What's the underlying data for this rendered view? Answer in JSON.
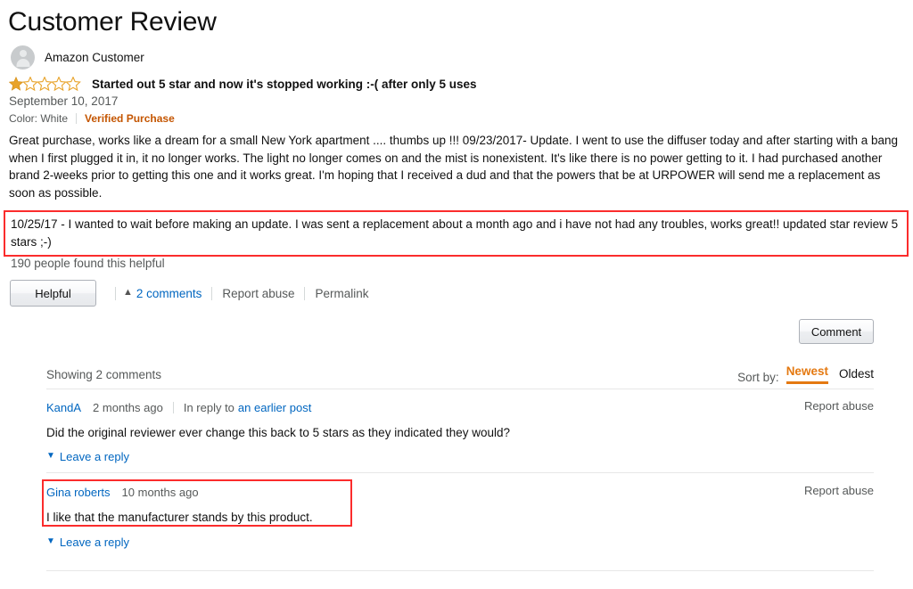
{
  "page": {
    "title": "Customer Review"
  },
  "reviewer": {
    "name": "Amazon Customer",
    "avatar_icon": "person-avatar-icon"
  },
  "review": {
    "rating_filled": 1,
    "rating_total": 5,
    "rating_icon": "star-icon",
    "headline": "Started out 5 star and now it's stopped working :-( after only 5 uses",
    "date": "September 10, 2017",
    "color_attribute": "Color: White",
    "verified_purchase": "Verified Purchase",
    "body": "Great purchase, works like a dream for a small New York apartment .... thumbs up !!! 09/23/2017- Update. I went to use the diffuser today and after starting with a bang when I first plugged it in, it no longer works. The light no longer comes on and the mist is nonexistent. It's like there is no power getting to it. I had purchased another brand 2-weeks prior to getting this one and it works great. I'm hoping that I received a dud and that the powers that be at URPOWER will send me a replacement as soon as possible.",
    "update_highlight": "10/25/17 - I wanted to wait before making an update. I was sent a replacement about a month ago and i have not had any troubles, works great!! updated star review 5 stars ;-)",
    "helpful_count_text": "190 people found this helpful"
  },
  "actions": {
    "helpful_label": "Helpful",
    "comments_link": "2 comments",
    "comments_caret_icon": "caret-up-icon",
    "report_abuse": "Report abuse",
    "permalink": "Permalink",
    "comment_button": "Comment"
  },
  "comments_section": {
    "showing_text": "Showing 2 comments",
    "sort_label": "Sort by:",
    "sort_options": [
      {
        "label": "Newest",
        "active": true
      },
      {
        "label": "Oldest",
        "active": false
      }
    ],
    "report_abuse": "Report abuse",
    "reply_label": "Leave a reply",
    "reply_chevron_icon": "chevron-down-icon",
    "items": [
      {
        "author": "KandA",
        "time": "2 months ago",
        "in_reply_to_prefix": "In reply to",
        "in_reply_to_link": "an earlier post",
        "body": "Did the original reviewer ever change this back to 5 stars as they indicated they would?",
        "report_abuse": "Report abuse",
        "reply_label": "Leave a reply"
      },
      {
        "author": "Gina roberts",
        "time": "10 months ago",
        "in_reply_to_prefix": "",
        "in_reply_to_link": "",
        "body": "I like that the manufacturer stands by this product.",
        "report_abuse": "Report abuse",
        "reply_label": "Leave a reply"
      }
    ]
  },
  "colors": {
    "highlight_box": "#fb2c2c",
    "star_fill": "#e8a32b",
    "link": "#0066c0",
    "accent_orange": "#e47911",
    "verified_orange": "#c45500",
    "muted_text": "#565959"
  }
}
